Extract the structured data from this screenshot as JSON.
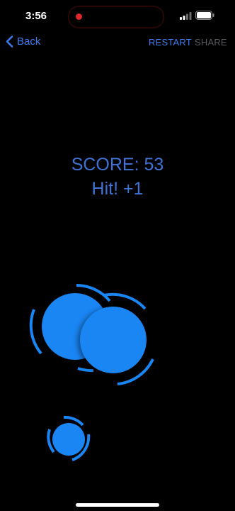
{
  "status_bar": {
    "time": "3:56",
    "recording_indicator_color": "#e0282c",
    "icons": [
      "signal-icon",
      "battery-icon"
    ]
  },
  "nav": {
    "back_label": "Back",
    "restart_label": "RESTART",
    "share_label": "SHARE",
    "accent_color": "#3c7df2",
    "disabled_color": "#5a5a5f"
  },
  "game": {
    "score_text": "SCORE: 53",
    "feedback_text": "Hit! +1",
    "ball_color": "#1a86f4",
    "ring_color": "#1a86f4"
  }
}
